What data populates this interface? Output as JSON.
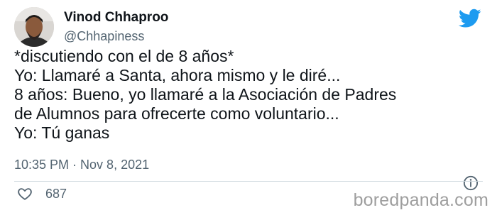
{
  "user": {
    "display_name": "Vinod Chhaproo",
    "handle": "@Chhapiness"
  },
  "tweet": {
    "lines": [
      "*discutiendo con el de 8 años*",
      "Yo: Llamaré a Santa, ahora mismo y le diré...",
      "8 años: Bueno, yo llamaré a la Asociación de Padres",
      "de Alumnos para ofrecerte como voluntario...",
      "Yo: Tú ganas"
    ],
    "timestamp": "10:35 PM · Nov 8, 2021",
    "likes": "687"
  },
  "icons": {
    "brand": "twitter-bird-icon",
    "info": "info-icon",
    "like": "heart-icon"
  },
  "colors": {
    "twitter_blue": "#1d9bf0",
    "secondary_text": "#536471",
    "primary_text": "#0f1419"
  },
  "watermark": "boredpanda.com"
}
